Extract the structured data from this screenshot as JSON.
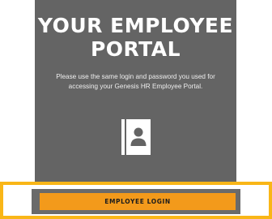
{
  "portal": {
    "heading_line1": "YOUR EMPLOYEE",
    "heading_line2": "PORTAL",
    "description_line1": "Please use the same login and password you used for",
    "description_line2": "accessing your Genesis HR Employee Portal.",
    "icon": "contact-book-icon"
  },
  "login": {
    "button_label": "EMPLOYEE LOGIN"
  },
  "colors": {
    "panel_background": "#646464",
    "button_orange": "#f39a1b",
    "highlight_border": "#f9b617",
    "heading_text": "#ffffff"
  }
}
